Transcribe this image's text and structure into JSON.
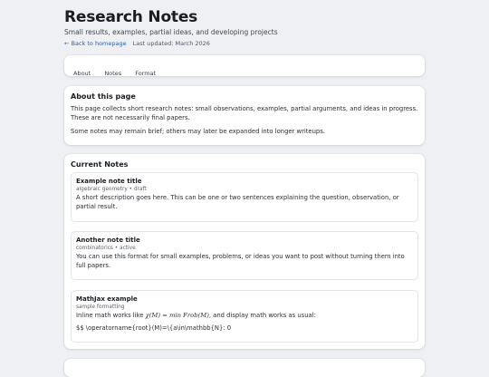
{
  "header": {
    "title": "Research Notes",
    "subtitle": "Small results, examples, partial ideas, and developing projects",
    "back_link": "← Back to homepage",
    "last_updated": "Last updated: March 2026"
  },
  "nav": {
    "items": [
      "About",
      "Notes",
      "Format"
    ]
  },
  "about": {
    "heading": "About this page",
    "paragraphs": [
      "This page collects short research notes: small observations, examples, partial arguments, and ideas in progress. These are not necessarily final papers.",
      "Some notes may remain brief; others may later be expanded into longer writeups."
    ]
  },
  "notes": {
    "heading": "Current Notes",
    "items": [
      {
        "title": "Example note title",
        "tag": "algebraic geometry • draft",
        "description": "A short description goes here. This can be one or two sentences explaining the question, observation, or partial result."
      },
      {
        "title": "Another note title",
        "tag": "combinatorics • active",
        "description": "You can use this format for small examples, problems, or ideas you want to post without turning them into full papers."
      },
      {
        "title": "MathJax example",
        "tag": "sample formatting",
        "inline_prefix": "Inline math works like ",
        "inline_math": "χ(M) = min Frob(M)",
        "inline_suffix": ", and display math works as usual:",
        "raw_display": "$$ \\operatorname{root}(M)=\\{a\\in\\mathbb{N}: 0"
      }
    ]
  }
}
